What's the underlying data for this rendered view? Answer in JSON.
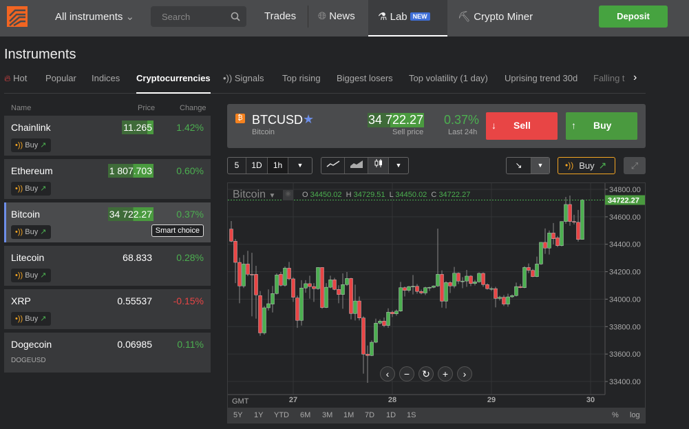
{
  "topbar": {
    "instruments": "All instruments",
    "search_placeholder": "Search",
    "trades": "Trades",
    "news": "News",
    "lab": "Lab",
    "lab_badge": "NEW",
    "crypto_miner": "Crypto Miner",
    "deposit": "Deposit"
  },
  "page_title": "Instruments",
  "tabs": [
    "Hot",
    "Popular",
    "Indices",
    "Cryptocurrencies",
    "Signals",
    "Top rising",
    "Biggest losers",
    "Top volatility (1 day)",
    "Uprising trend 30d",
    "Falling t"
  ],
  "list": {
    "headers": {
      "name": "Name",
      "price": "Price",
      "change": "Change"
    },
    "rows": [
      {
        "name": "Chainlink",
        "price": "11.265",
        "change": "1.42%",
        "buy": "Buy"
      },
      {
        "name": "Ethereum",
        "price": "1 807.703",
        "change": "0.60%",
        "buy": "Buy"
      },
      {
        "name": "Bitcoin",
        "price": "34 722.27",
        "change": "0.37%",
        "buy": "Buy",
        "tag": "Smart choice"
      },
      {
        "name": "Litecoin",
        "price": "68.833",
        "change": "0.28%",
        "buy": "Buy"
      },
      {
        "name": "XRP",
        "price": "0.55537",
        "change": "-0.15%",
        "buy": "Buy"
      },
      {
        "name": "Dogecoin",
        "price": "0.06985",
        "change": "0.11%",
        "sub": "DOGEUSD"
      }
    ]
  },
  "instrument": {
    "symbol": "BTCUSD",
    "name": "Bitcoin",
    "price": "34 722.27",
    "price_label": "Sell price",
    "change": "0.37%",
    "change_label": "Last 24h",
    "sell": "Sell",
    "buy": "Buy"
  },
  "toolbar": {
    "p1": "5",
    "p2": "1D",
    "p3": "1h",
    "buy": "Buy"
  },
  "chart_data": {
    "type": "candlestick",
    "title": "Bitcoin",
    "ohlc_label": {
      "o": "34450.02",
      "h": "34729.51",
      "l": "34450.02",
      "c": "34722.27"
    },
    "last": "34722.27",
    "ylim": [
      33350,
      34850
    ],
    "yticks": [
      "34800.00",
      "34600.00",
      "34400.00",
      "34200.00",
      "34000.00",
      "33800.00",
      "33600.00",
      "33400.00"
    ],
    "xticks": [
      "27",
      "28",
      "29",
      "30"
    ],
    "timezone": "GMT",
    "candles": [
      [
        34511,
        34569,
        34415,
        34422
      ],
      [
        34422,
        34439,
        34117,
        34268
      ],
      [
        34268,
        34302,
        33970,
        34096
      ],
      [
        34096,
        34322,
        34081,
        34256
      ],
      [
        34256,
        34352,
        34168,
        34181
      ],
      [
        34181,
        34338,
        33875,
        34180
      ],
      [
        34181,
        34243,
        33858,
        34031
      ],
      [
        34026,
        34059,
        33733,
        33754
      ],
      [
        33754,
        33950,
        33741,
        33937
      ],
      [
        33937,
        34071,
        33917,
        33967
      ],
      [
        33964,
        34096,
        33903,
        34041
      ],
      [
        34041,
        34188,
        34034,
        34176
      ],
      [
        34181,
        34198,
        34092,
        34101
      ],
      [
        34101,
        34238,
        34092,
        34226
      ],
      [
        34226,
        34271,
        34138,
        34148
      ],
      [
        34148,
        34159,
        33980,
        34014
      ],
      [
        34009,
        34026,
        33791,
        33845
      ],
      [
        33845,
        34138,
        33808,
        34081
      ],
      [
        34081,
        34138,
        34047,
        34113
      ],
      [
        34113,
        34171,
        34004,
        34092
      ],
      [
        34092,
        34117,
        33980,
        34076
      ],
      [
        34076,
        34231,
        34068,
        34231
      ],
      [
        34231,
        34231,
        33930,
        33939
      ],
      [
        33939,
        34117,
        33935,
        34087
      ],
      [
        34087,
        34171,
        34080,
        34141
      ],
      [
        34141,
        34155,
        34064,
        34071
      ],
      [
        34071,
        34101,
        33970,
        34034
      ],
      [
        34034,
        34188,
        33930,
        34106
      ],
      [
        34106,
        34198,
        34096,
        34151
      ],
      [
        34151,
        34155,
        33853,
        33895
      ],
      [
        33895,
        34106,
        33845,
        33987
      ],
      [
        33987,
        34020,
        33845,
        33863
      ],
      [
        33863,
        33875,
        33457,
        33599
      ],
      [
        33599,
        33662,
        33390,
        33589
      ],
      [
        33589,
        33700,
        33585,
        33686
      ],
      [
        33686,
        33858,
        33680,
        33825
      ],
      [
        33825,
        33853,
        33815,
        33840
      ],
      [
        33840,
        33866,
        33796,
        33808
      ],
      [
        33808,
        33933,
        33791,
        33905
      ],
      [
        33905,
        33917,
        33870,
        33893
      ],
      [
        33893,
        33925,
        33880,
        33913
      ],
      [
        33913,
        34126,
        33908,
        34084
      ],
      [
        34084,
        34092,
        34020,
        34064
      ],
      [
        34064,
        34096,
        34050,
        34092
      ],
      [
        34092,
        34176,
        34034,
        34094
      ],
      [
        34094,
        34110,
        34040,
        34056
      ],
      [
        34056,
        34070,
        34035,
        34045
      ],
      [
        34045,
        34090,
        34030,
        34084
      ],
      [
        34084,
        34090,
        34060,
        34086
      ],
      [
        34086,
        34100,
        34080,
        34096
      ],
      [
        34096,
        34514,
        34090,
        34181
      ],
      [
        34181,
        34210,
        33938,
        33985
      ],
      [
        33985,
        34130,
        33933,
        34121
      ],
      [
        34121,
        34130,
        34045,
        34096
      ],
      [
        34096,
        34235,
        34080,
        34189
      ],
      [
        34189,
        34195,
        34110,
        34131
      ],
      [
        34131,
        34160,
        34080,
        34132
      ],
      [
        34132,
        34213,
        34090,
        34168
      ],
      [
        34168,
        34175,
        34095,
        34114
      ],
      [
        34114,
        34140,
        34100,
        34126
      ],
      [
        34126,
        34195,
        34120,
        34188
      ],
      [
        34188,
        34195,
        34090,
        34106
      ],
      [
        34106,
        34115,
        34070,
        34076
      ],
      [
        34076,
        34090,
        34060,
        34077
      ],
      [
        34077,
        34090,
        33940,
        34005
      ],
      [
        34005,
        34025,
        33990,
        34014
      ],
      [
        34014,
        34030,
        33950,
        33964
      ],
      [
        33964,
        34040,
        33945,
        34017
      ],
      [
        34017,
        34035,
        34010,
        34026
      ],
      [
        34026,
        34121,
        34020,
        34092
      ],
      [
        34092,
        34110,
        34080,
        34084
      ],
      [
        34084,
        34240,
        34080,
        34231
      ],
      [
        34231,
        34260,
        34190,
        34210
      ],
      [
        34210,
        34220,
        34160,
        34164
      ],
      [
        34164,
        34310,
        34160,
        34256
      ],
      [
        34256,
        34414,
        34250,
        34414
      ],
      [
        34414,
        34515,
        34330,
        34372
      ],
      [
        34372,
        34500,
        34325,
        34482
      ],
      [
        34482,
        34555,
        34400,
        34440
      ],
      [
        34447,
        34460,
        34380,
        34390
      ],
      [
        34390,
        34566,
        34385,
        34566
      ],
      [
        34566,
        34745,
        34550,
        34690
      ],
      [
        34690,
        34755,
        34535,
        34566
      ],
      [
        34566,
        34615,
        34545,
        34560
      ],
      [
        34560,
        34650,
        34420,
        34435
      ],
      [
        34435,
        34729,
        34435,
        34722
      ]
    ]
  },
  "ranges": [
    "5Y",
    "1Y",
    "YTD",
    "6M",
    "3M",
    "1M",
    "7D",
    "1D",
    "1S"
  ],
  "scale": {
    "pct": "%",
    "log": "log"
  },
  "colors": {
    "up": "#4caf50",
    "down": "#e84545",
    "accent": "#f26522"
  }
}
